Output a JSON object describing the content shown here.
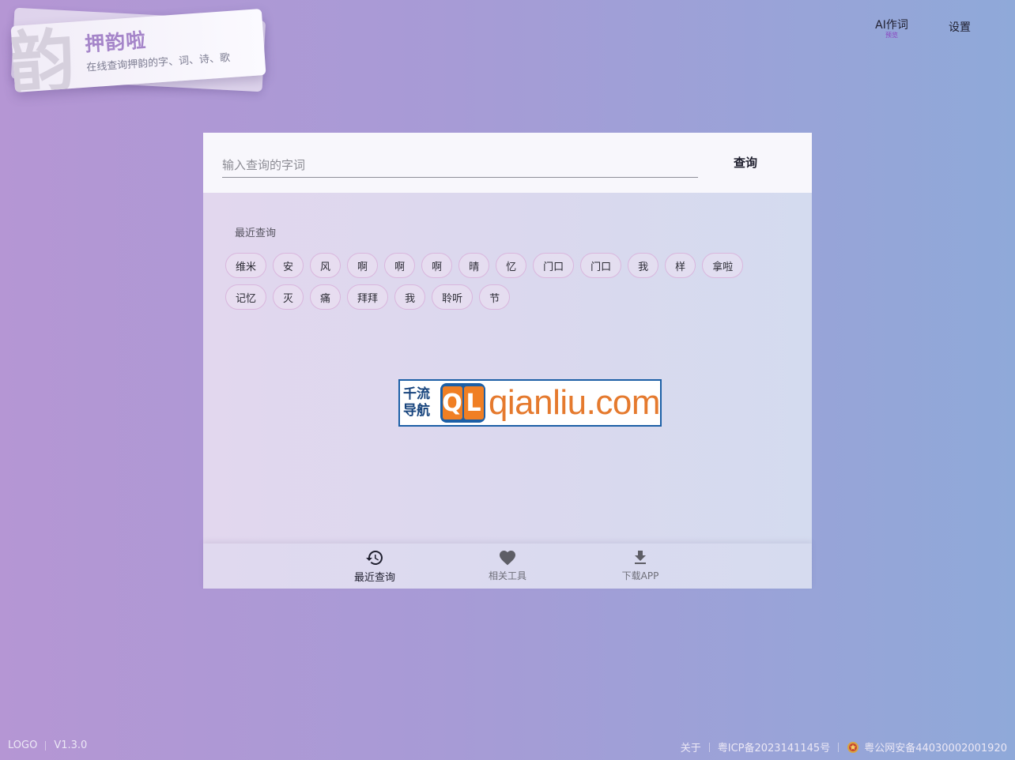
{
  "logo": {
    "glyph": "韵",
    "title": "押韵啦",
    "subtitle": "在线查询押韵的字、词、诗、歌"
  },
  "nav": {
    "ai_label": "AI作词",
    "ai_badge": "预览",
    "settings_label": "设置"
  },
  "search": {
    "placeholder": "输入查询的字词",
    "value": "",
    "button_label": "查询"
  },
  "recent": {
    "title": "最近查询",
    "items": [
      "维米",
      "安",
      "风",
      "啊",
      "啊",
      "啊",
      "晴",
      "忆",
      "门口",
      "门口",
      "我",
      "样",
      "拿啦",
      "记忆",
      "灭",
      "痛",
      "拜拜",
      "我",
      "聆听",
      "节"
    ]
  },
  "ad": {
    "cn_line1": "千流",
    "cn_line2": "导航",
    "q": "Q",
    "l": "L",
    "domain": "qianliu.com"
  },
  "tabs": [
    {
      "label": "最近查询",
      "icon": "history-icon",
      "active": true
    },
    {
      "label": "相关工具",
      "icon": "heart-icon",
      "active": false
    },
    {
      "label": "下载APP",
      "icon": "download-icon",
      "active": false
    }
  ],
  "footer": {
    "logo_label": "LOGO",
    "version": "V1.3.0",
    "about": "关于",
    "icp": "粤ICP备2023141145号",
    "police": "粤公网安备44030002001920"
  },
  "colors": {
    "background_left": "#b596d4",
    "background_right": "#8fa9d9",
    "brand_purple": "#a585c9",
    "chip_border": "#d9b6dd",
    "ad_blue": "#1c5fa6",
    "ad_orange": "#e57a2e"
  }
}
